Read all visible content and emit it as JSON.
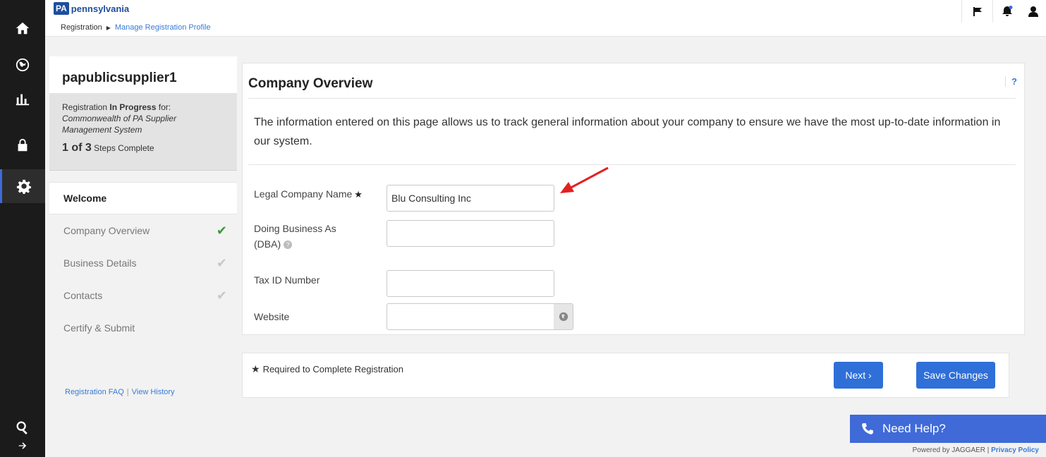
{
  "header": {
    "logo_badge": "PA",
    "logo_text": "pennsylvania",
    "breadcrumb": [
      "Registration",
      "Manage Registration Profile"
    ]
  },
  "nav_rail": {
    "icons": [
      "home-icon",
      "globe-icon",
      "bar-chart-icon",
      "lock-icon",
      "gear-icon",
      "search-icon",
      "arrow-right-icon"
    ],
    "active": "gear-icon"
  },
  "steps_panel": {
    "supplier_name": "papublicsupplier1",
    "status_prefix": "Registration",
    "status_bold": "In Progress",
    "status_suffix": "for:",
    "program": "Commonwealth of PA Supplier Management System",
    "steps_done": "1 of 3",
    "steps_suffix": "Steps Complete",
    "steps": [
      {
        "label": "Welcome",
        "status": "current"
      },
      {
        "label": "Company Overview",
        "status": "done"
      },
      {
        "label": "Business Details",
        "status": "todo"
      },
      {
        "label": "Contacts",
        "status": "todo"
      },
      {
        "label": "Certify & Submit",
        "status": "none"
      }
    ],
    "links": [
      "Registration FAQ",
      "View History"
    ]
  },
  "main": {
    "title": "Company Overview",
    "help_label": "?",
    "intro": "The information entered on this page allows us to track general information about your company to ensure we have the most up-to-date information in our system.",
    "fields": {
      "legal_name_label": "Legal Company Name",
      "legal_name_value": "Blu Consulting Inc",
      "dba_label_1": "Doing Business As",
      "dba_label_2": "(DBA)",
      "dba_value": "",
      "tax_label": "Tax ID Number",
      "tax_value": "",
      "website_label": "Website",
      "website_value": ""
    }
  },
  "actions": {
    "required_note": "Required to Complete Registration",
    "next_label": "Next ›",
    "save_label": "Save Changes"
  },
  "help": {
    "need_help": "Need Help?",
    "powered_by": "Powered by JAGGAER |",
    "privacy": "Privacy Policy"
  },
  "colors": {
    "accent": "#2f6fd8",
    "rail": "#1b1b1b",
    "done_check": "#3c9a3c",
    "annotation": "#e32020"
  }
}
